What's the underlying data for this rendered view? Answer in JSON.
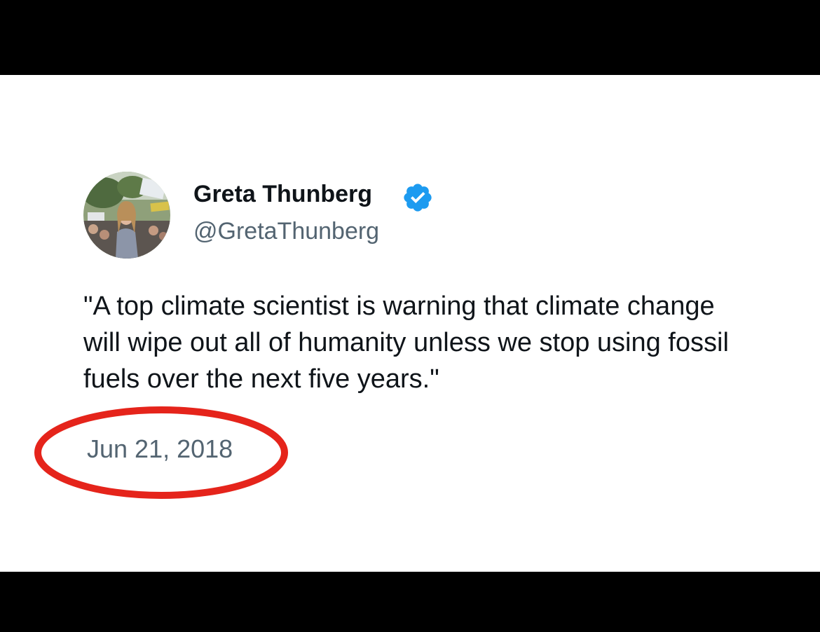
{
  "tweet": {
    "author_name": "Greta Thunberg",
    "handle": "@GretaThunberg",
    "verified": true,
    "verified_color": "#1d9bf0",
    "text": "\"A top climate scientist is warning that climate change will wipe out all of humanity unless we stop using fossil fuels over the next five years.\"",
    "date": "Jun 21, 2018"
  },
  "annotation": {
    "shape": "ellipse",
    "color": "#e5241b",
    "target": "date"
  }
}
